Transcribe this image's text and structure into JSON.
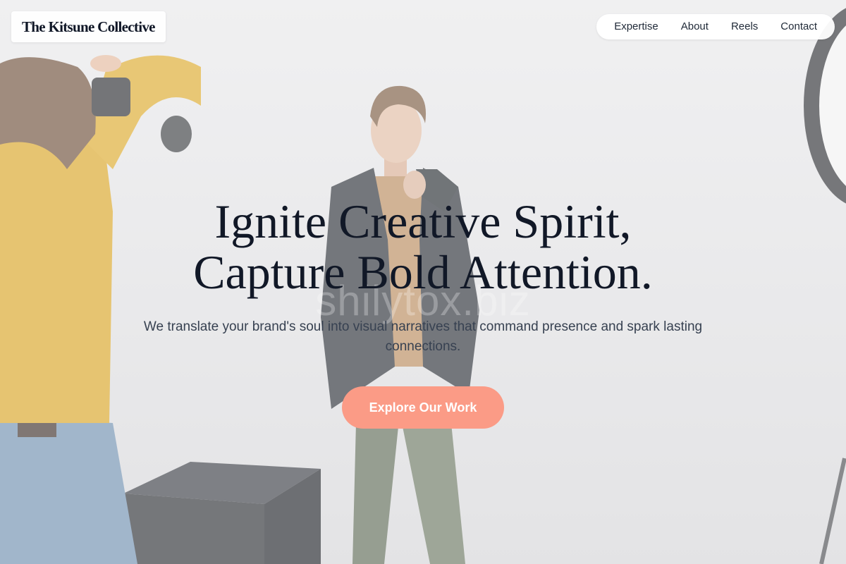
{
  "brand": {
    "name": "The Kitsune Collective"
  },
  "nav": {
    "items": [
      {
        "label": "Expertise"
      },
      {
        "label": "About"
      },
      {
        "label": "Reels"
      },
      {
        "label": "Contact"
      }
    ]
  },
  "hero": {
    "headline_line1": "Ignite Creative Spirit,",
    "headline_line2": "Capture Bold Attention.",
    "subheadline": "We translate your brand's soul into visual narratives that command presence and spark lasting connections.",
    "cta_label": "Explore Our Work",
    "watermark_text": "shilytox.biz"
  },
  "colors": {
    "cta_background": "#fb9b86",
    "headline": "#111827",
    "subheadline": "#374151"
  }
}
